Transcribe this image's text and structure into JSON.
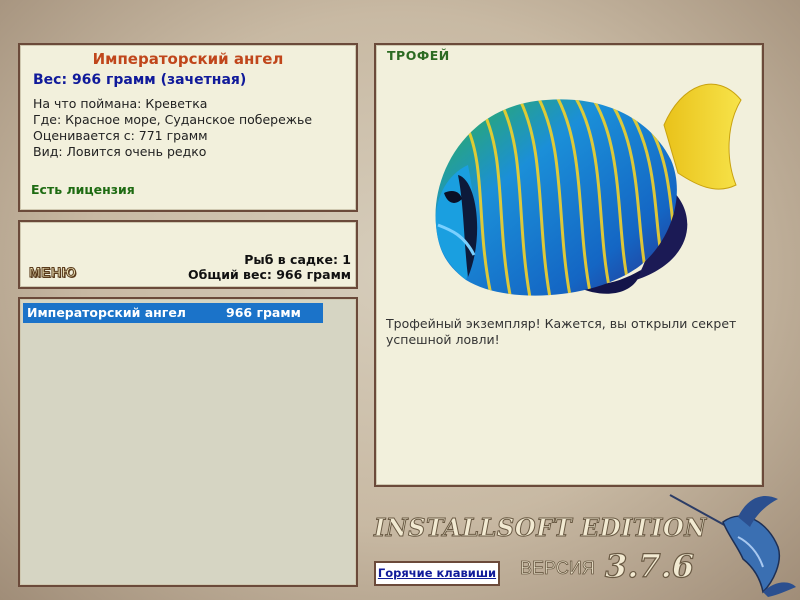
{
  "info": {
    "fish_name": "Императорский ангел",
    "weight": "Вес: 966 грамм (зачетная)",
    "caught_on": "На что поймана: Креветка",
    "where": "Где: Красное море, Суданское побережье",
    "valued_from": "Оценивается с: 771 грамм",
    "kind": "Вид: Ловится очень редко",
    "license": "Есть лицензия"
  },
  "menu": {
    "button_label": "МЕНЮ",
    "fish_in_cage": "Рыб в садке: 1",
    "total_weight": "Общий вес: 966 грамм"
  },
  "catch_list": [
    {
      "name": "Императорский ангел",
      "weight": "966 грамм"
    }
  ],
  "trophy": {
    "label": "ТРОФЕЙ",
    "description": "Трофейный экземпляр! Кажется, вы открыли секрет успешной ловли!"
  },
  "footer": {
    "brand": "INSTALLSOFT EDITION",
    "hotkeys": "Горячие клавиши",
    "version_label": "ВЕРСИЯ",
    "version": "3.7.6"
  },
  "colors": {
    "panel_bg": "#f2f0dc",
    "panel_border": "#6b4a3a",
    "selected_row": "#1b73c9",
    "title": "#c0461b",
    "weight": "#101a9a",
    "license": "#1e6b12"
  }
}
